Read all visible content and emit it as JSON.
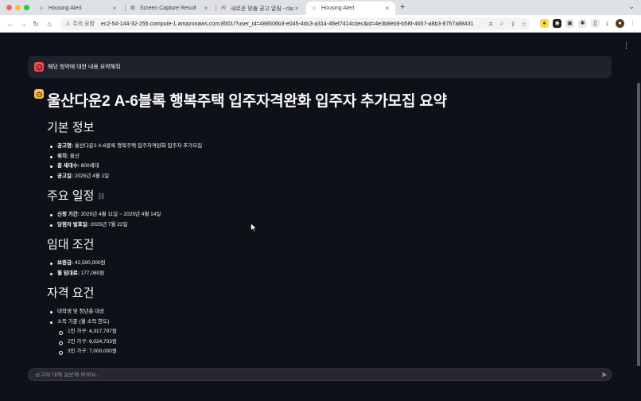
{
  "browser": {
    "tabs": [
      {
        "title": "Housing Alert",
        "favicon": "house-icon"
      },
      {
        "title": "Screen Capture Result",
        "favicon": "gear-icon"
      },
      {
        "title": "새로운 맞춤 공고 알림 - rlaxowl",
        "favicon": "mail-icon"
      },
      {
        "title": "Housing Alert",
        "favicon": "house-icon"
      }
    ],
    "security_label": "주의 요함",
    "url": "ec2-54-144-32-255.compute-1.amazonaws.com:8501/?user_id=488506b3-e045-4dc3-a314-46ef7414cdec&id=4e3b8eb9-b58f-4657-a8b3-8757a88431"
  },
  "chat": {
    "user_message": "해당 청약에 대한 내용 요약해줘",
    "input_placeholder": "공고에 대해 질문해 보세요..."
  },
  "summary": {
    "title": "울산다운2 A-6블록 행복주택 입주자격완화 입주자 추가모집 요약",
    "sections": {
      "basic": {
        "heading": "기본 정보",
        "items": [
          {
            "label": "공고명:",
            "value": " 울산다운2 A-6블록 행복주택 입주자격완화 입주자 추가모집"
          },
          {
            "label": "위치:",
            "value": " 울산"
          },
          {
            "label": "총 세대수:",
            "value": " 800세대"
          },
          {
            "label": "공고일:",
            "value": " 2025년 4월 1일"
          }
        ]
      },
      "schedule": {
        "heading": "주요 일정",
        "items": [
          {
            "label": "신청 기간:",
            "value": " 2025년 4월 11일 ~ 2025년 4월 14일"
          },
          {
            "label": "당첨자 발표일:",
            "value": " 2025년 7월 22일"
          }
        ]
      },
      "rent": {
        "heading": "임대 조건",
        "items": [
          {
            "label": "보증금:",
            "value": " 42,500,000원"
          },
          {
            "label": "월 임대료:",
            "value": " 177,080원"
          }
        ]
      },
      "eligibility": {
        "heading": "자격 요건",
        "items": [
          "대학생 및 청년층 대상",
          "소득 기준 (월 소득 한도)"
        ],
        "sub_items": [
          "1인 가구: 4,317,797원",
          "2인 가구: 6,024,703원",
          "3인 가구: 7,000,000원"
        ]
      }
    }
  }
}
